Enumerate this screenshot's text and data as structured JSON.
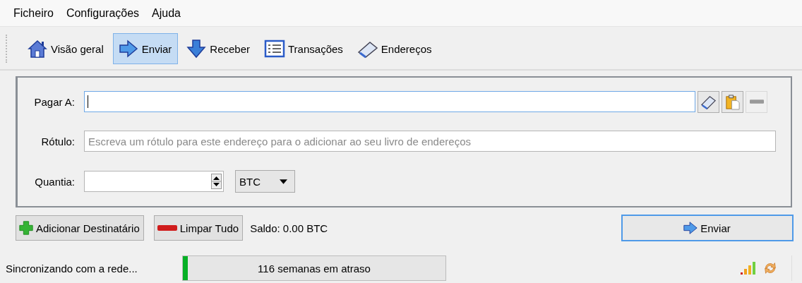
{
  "menu": [
    "Ficheiro",
    "Configurações",
    "Ajuda"
  ],
  "toolbar": [
    {
      "label": "Visão geral",
      "kind": "home",
      "selected": false
    },
    {
      "label": "Enviar",
      "kind": "send",
      "selected": true
    },
    {
      "label": "Receber",
      "kind": "receive",
      "selected": false
    },
    {
      "label": "Transações",
      "kind": "list",
      "selected": false
    },
    {
      "label": "Endereços",
      "kind": "book",
      "selected": false
    }
  ],
  "form": {
    "pay_to": {
      "label": "Pagar A:"
    },
    "label_field": {
      "label": "Rótulo:",
      "placeholder": "Escreva um rótulo para este endereço para o adicionar ao seu livro de endereços"
    },
    "amount": {
      "label": "Quantia:",
      "unit": "BTC"
    }
  },
  "actions": {
    "add_recipient": "Adicionar Destinatário",
    "clear_all": "Limpar Tudo",
    "balance": "Saldo: 0.00 BTC",
    "send": "Enviar"
  },
  "status_bar": {
    "message": "Sincronizando com a rede...",
    "progress": {
      "label": "116 semanas em atraso",
      "level": 0.02
    }
  }
}
